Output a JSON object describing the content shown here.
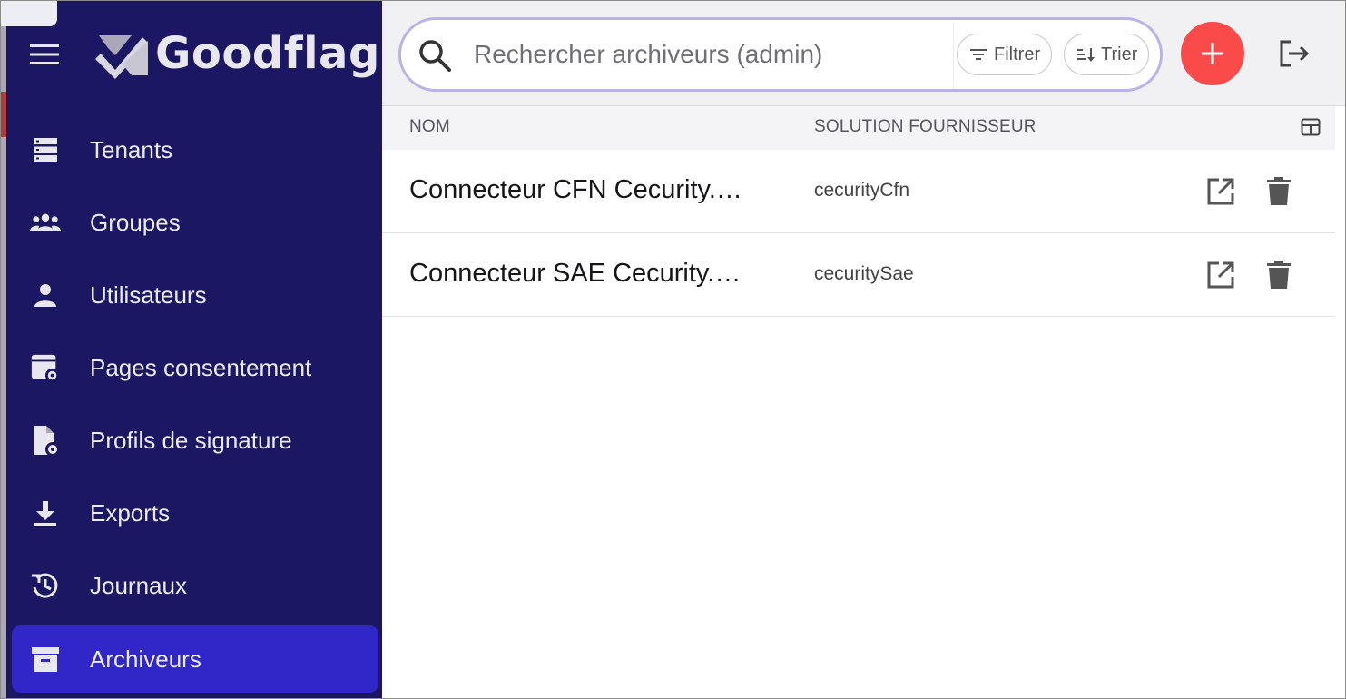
{
  "app": {
    "brand": "Goodflag"
  },
  "sidebar": {
    "items": [
      {
        "label": "Tenants",
        "icon": "server-icon"
      },
      {
        "label": "Groupes",
        "icon": "group-icon"
      },
      {
        "label": "Utilisateurs",
        "icon": "person-icon"
      },
      {
        "label": "Pages consentement",
        "icon": "page-settings-icon"
      },
      {
        "label": "Profils de signature",
        "icon": "file-settings-icon"
      },
      {
        "label": "Exports",
        "icon": "download-icon"
      },
      {
        "label": "Journaux",
        "icon": "history-icon"
      },
      {
        "label": "Archiveurs",
        "icon": "archive-icon",
        "active": true
      }
    ]
  },
  "search": {
    "placeholder": "Rechercher archiveurs (admin)",
    "value": "",
    "filter_label": "Filtrer",
    "sort_label": "Trier"
  },
  "table": {
    "columns": [
      "NOM",
      "SOLUTION FOURNISSEUR"
    ],
    "rows": [
      {
        "name": "Connecteur CFN Cecurity.…",
        "solution": "cecurityCfn"
      },
      {
        "name": "Connecteur SAE Cecurity.…",
        "solution": "cecuritySae"
      }
    ]
  },
  "colors": {
    "sidebar_bg": "#1c1763",
    "active_item": "#3127c9",
    "add_button": "#fb4a4a",
    "search_border": "#b9b3ea"
  }
}
